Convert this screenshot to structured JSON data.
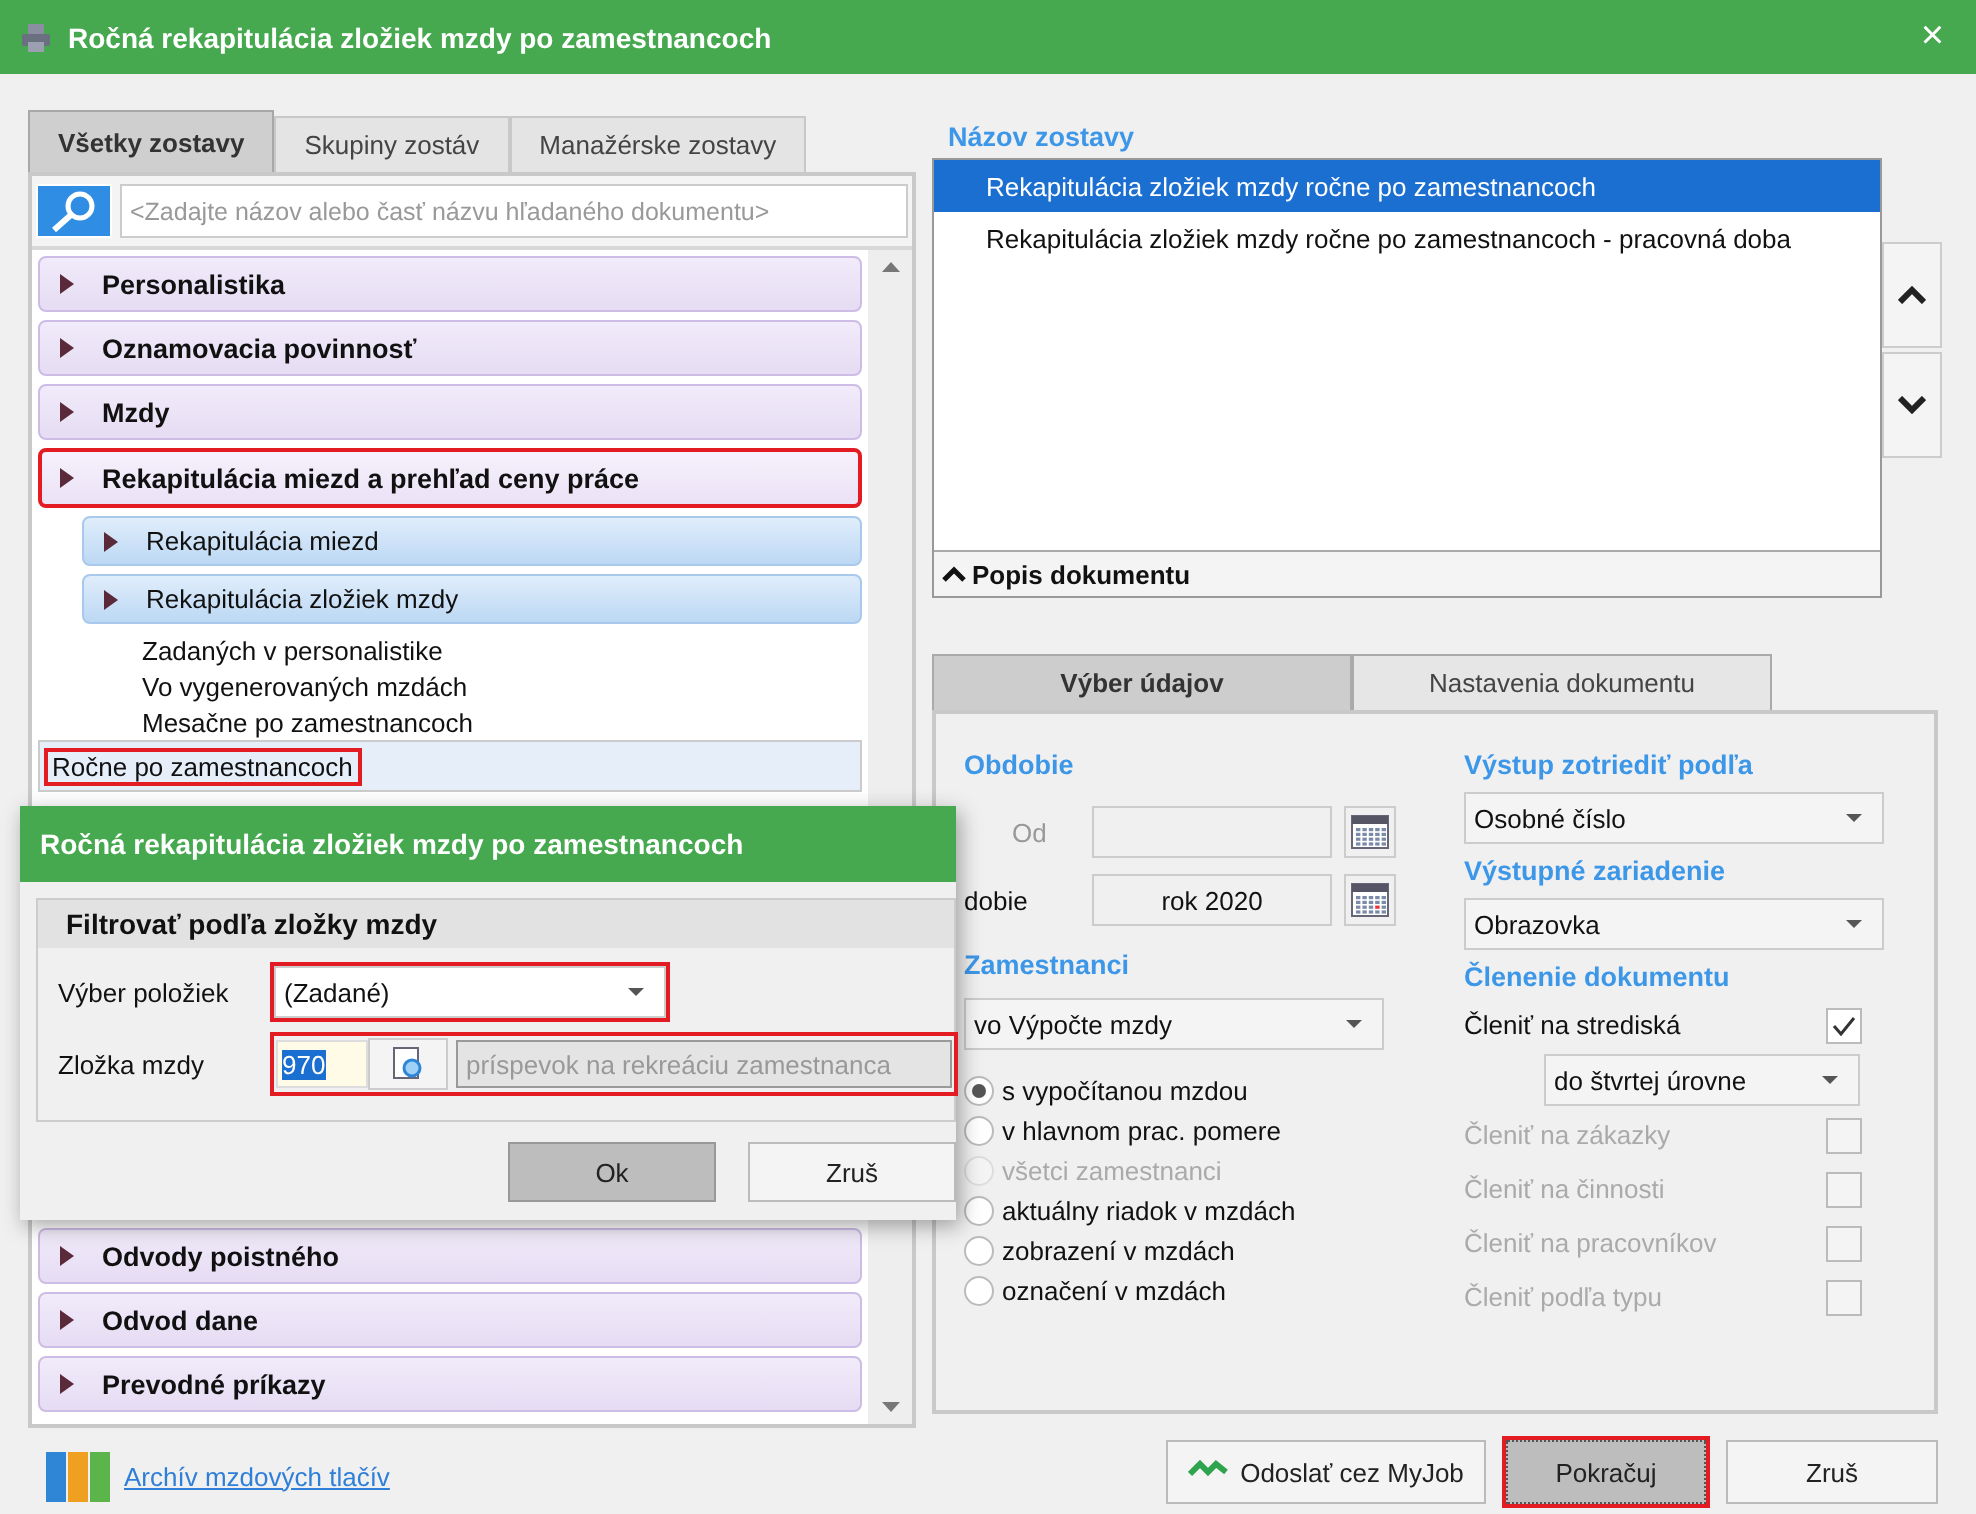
{
  "window": {
    "title": "Ročná rekapitulácia zložiek mzdy po zamestnancoch",
    "close": "×"
  },
  "left_tabs": [
    {
      "label": "Všetky zostavy",
      "selected": true
    },
    {
      "label": "Skupiny zostáv",
      "selected": false
    },
    {
      "label": "Manažérske zostavy",
      "selected": false
    }
  ],
  "search": {
    "placeholder": "<Zadajte názov alebo časť názvu hľadaného dokumentu>"
  },
  "tree": [
    {
      "label": "Personalistika",
      "highlighted": false
    },
    {
      "label": "Oznamovacia povinnosť",
      "highlighted": false
    },
    {
      "label": "Mzdy",
      "highlighted": false
    },
    {
      "label": "Rekapitulácia miezd a prehľad ceny práce",
      "highlighted": true,
      "children": [
        {
          "label": "Rekapitulácia miezd"
        },
        {
          "label": "Rekapitulácia zložiek mzdy",
          "children": [
            {
              "label": "Zadaných v personalistike",
              "selected": false,
              "highlighted": false
            },
            {
              "label": "Vo vygenerovaných mzdách",
              "selected": false,
              "highlighted": false
            },
            {
              "label": "Mesačne po zamestnancoch",
              "selected": false,
              "highlighted": false
            },
            {
              "label": "Ročne po zamestnancoch",
              "selected": true,
              "highlighted": true
            }
          ]
        }
      ]
    },
    {
      "label": "Odvody poistného",
      "highlighted": false
    },
    {
      "label": "Odvod dane",
      "highlighted": false
    },
    {
      "label": "Prevodné príkazy",
      "highlighted": false
    }
  ],
  "archive_link": "Archív mzdových tlačív",
  "report_list": {
    "title": "Názov zostavy",
    "items": [
      {
        "label": "Rekapitulácia zložiek mzdy ročne po zamestnancoch",
        "selected": true
      },
      {
        "label": "Rekapitulácia zložiek mzdy ročne po zamestnancoch - pracovná doba",
        "selected": false
      }
    ],
    "description_toggle": "Popis dokumentu"
  },
  "data_tabs": [
    {
      "label": "Výber údajov",
      "selected": true
    },
    {
      "label": "Nastavenia dokumentu",
      "selected": false
    }
  ],
  "period": {
    "heading": "Obdobie",
    "from_label": "Od",
    "period_label": "dobie",
    "period_value": "rok 2020"
  },
  "employees": {
    "heading": "Zamestnanci",
    "select": "vo Výpočte mzdy",
    "options": [
      {
        "label": "s vypočítanou mzdou",
        "selected": true,
        "disabled": false
      },
      {
        "label": "v hlavnom prac. pomere",
        "selected": false,
        "disabled": false
      },
      {
        "label": "všetci zamestnanci",
        "selected": false,
        "disabled": true
      },
      {
        "label": "aktuálny riadok v mzdách",
        "selected": false,
        "disabled": false
      },
      {
        "label": "zobrazení v mzdách",
        "selected": false,
        "disabled": false
      },
      {
        "label": "označení v mzdách",
        "selected": false,
        "disabled": false
      }
    ]
  },
  "sort": {
    "heading": "Výstup zotriediť podľa",
    "value": "Osobné číslo"
  },
  "device": {
    "heading": "Výstupné zariadenie",
    "value": "Obrazovka"
  },
  "breakdown": {
    "heading": "Členenie dokumentu",
    "level_select": "do štvrtej úrovne",
    "options": [
      {
        "label": "Členiť na strediská",
        "checked": true,
        "disabled": false
      },
      {
        "label": "Členiť na zákazky",
        "checked": false,
        "disabled": true
      },
      {
        "label": "Členiť na činnosti",
        "checked": false,
        "disabled": true
      },
      {
        "label": "Členiť na pracovníkov",
        "checked": false,
        "disabled": true
      },
      {
        "label": "Členiť podľa typu",
        "checked": false,
        "disabled": true
      }
    ]
  },
  "buttons": [
    {
      "label": "Odoslať cez MyJob",
      "kind": "send",
      "highlighted": false
    },
    {
      "label": "Pokračuj",
      "kind": "default",
      "highlighted": true
    },
    {
      "label": "Zruš",
      "kind": "plain",
      "highlighted": false
    }
  ],
  "dialog": {
    "title": "Ročná rekapitulácia zložiek mzdy po zamestnancoch",
    "group_title": "Filtrovať podľa zložky mzdy",
    "items_label": "Výber položiek",
    "items_value": "(Zadané)",
    "items_highlighted": true,
    "component_label": "Zložka mzdy",
    "component_code": "970",
    "component_description": "príspevok na rekreáciu zamestnanca",
    "component_highlighted": true,
    "buttons": [
      {
        "label": "Ok",
        "kind": "default"
      },
      {
        "label": "Zruš",
        "kind": "plain"
      }
    ]
  }
}
